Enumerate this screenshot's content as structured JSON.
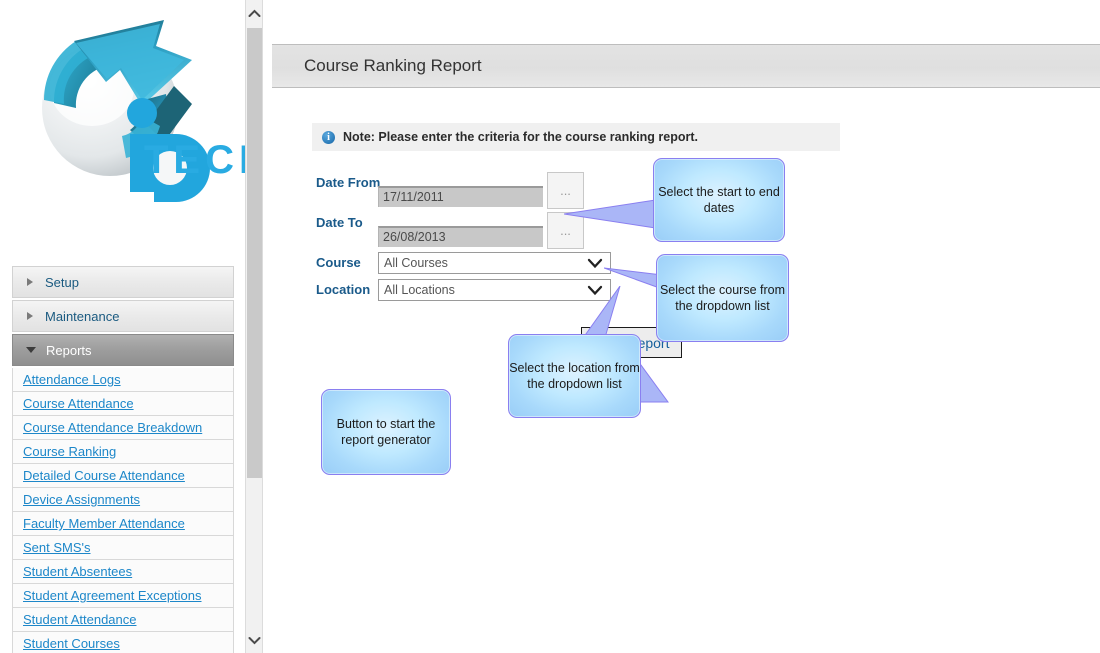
{
  "logo": {
    "brand_text": "TECH",
    "icon_name": "iptech-logo",
    "accent_color": "#29abe2",
    "dark_teal": "#1d6b80"
  },
  "sidebar": {
    "sections": [
      {
        "label": "Setup",
        "expanded": false,
        "icon": "triangle-right-icon"
      },
      {
        "label": "Maintenance",
        "expanded": false,
        "icon": "triangle-right-icon"
      },
      {
        "label": "Reports",
        "expanded": true,
        "icon": "triangle-down-icon"
      }
    ],
    "report_links": [
      "Attendance Logs",
      "Course Attendance",
      "Course Attendance Breakdown",
      "Course Ranking",
      "Detailed Course Attendance",
      "Device Assignments",
      "Faculty Member Attendance",
      "Sent SMS's",
      "Student Absentees",
      "Student Agreement Exceptions",
      "Student Attendance",
      "Student Courses"
    ],
    "link_color": "#1d87c9"
  },
  "scrollbar": {
    "up_icon": "chevron-up-icon",
    "down_icon": "chevron-down-icon",
    "thumb_name": "scrollbar-thumb"
  },
  "header": {
    "title": "Course Ranking Report"
  },
  "note": {
    "icon": "info-icon",
    "icon_glyph": "i",
    "text": "Note: Please enter the criteria for the course ranking report."
  },
  "form": {
    "date_from": {
      "label": "Date From",
      "value": "17/11/2011",
      "picker_label": "...",
      "picker_icon": "ellipsis-icon"
    },
    "date_to": {
      "label": "Date To",
      "value": "26/08/2013",
      "picker_label": "...",
      "picker_icon": "ellipsis-icon"
    },
    "course": {
      "label": "Course",
      "value": "All Courses",
      "chevron_icon": "chevron-down-icon"
    },
    "location": {
      "label": "Location",
      "value": "All Locations",
      "chevron_icon": "chevron-down-icon"
    },
    "view_report_label": "View Report"
  },
  "callouts": [
    {
      "name": "callout-dates",
      "text": "Select the start to end dates"
    },
    {
      "name": "callout-course",
      "text": "Select the course from the dropdown list"
    },
    {
      "name": "callout-location",
      "text": "Select the location from the dropdown list"
    },
    {
      "name": "callout-view-report",
      "text": "Button to start the report generator"
    }
  ],
  "colors": {
    "callout_fill": "#bfe9ff",
    "callout_border": "#8a7ff0",
    "label_blue": "#1a5a8a",
    "note_bg": "#f0f0f0",
    "header_bg": "#e0e0e0"
  }
}
